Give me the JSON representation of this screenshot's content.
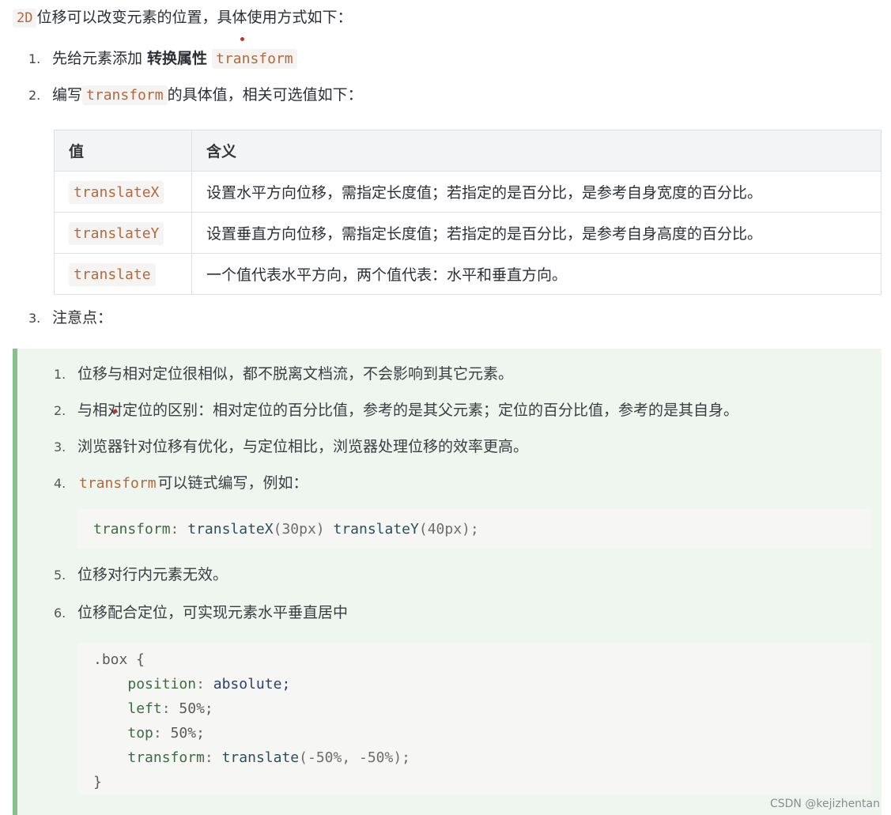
{
  "intro": {
    "code": "2D",
    "text": "位移可以改变元素的位置，具体使用方式如下："
  },
  "steps": [
    {
      "num": "1.",
      "text_before": "先给元素添加 ",
      "bold": "转换属性",
      "code": "transform"
    },
    {
      "num": "2.",
      "text_before": "编写",
      "code": "transform",
      "text_after": "的具体值，相关可选值如下："
    },
    {
      "num": "3.",
      "text": "注意点："
    }
  ],
  "table": {
    "headers": [
      "值",
      "含义"
    ],
    "rows": [
      {
        "value": "translateX",
        "meaning": "设置水平方向位移，需指定长度值；若指定的是百分比，是参考自身宽度的百分比。"
      },
      {
        "value": "translateY",
        "meaning": "设置垂直方向位移，需指定长度值；若指定的是百分比，是参考自身高度的百分比。"
      },
      {
        "value": "translate",
        "meaning": "一个值代表水平方向，两个值代表：水平和垂直方向。"
      }
    ]
  },
  "notes": [
    {
      "num": "1.",
      "text": "位移与相对定位很相似，都不脱离文档流，不会影响到其它元素。"
    },
    {
      "num": "2.",
      "text": "与相对定位的区别：相对定位的百分比值，参考的是其父元素；定位的百分比值，参考的是其自身。"
    },
    {
      "num": "3.",
      "text": "浏览器针对位移有优化，与定位相比，浏览器处理位移的效率更高。"
    },
    {
      "num": "4.",
      "code": "transform",
      "text": "可以链式编写，例如："
    },
    {
      "num": "5.",
      "text": "位移对行内元素无效。"
    },
    {
      "num": "6.",
      "text": "位移配合定位，可实现元素水平垂直居中"
    }
  ],
  "code1": {
    "prop": "transform",
    "colon": ": ",
    "fn1": "translateX",
    "arg1": "(30px)",
    "fn2": "translateY",
    "arg2": "(40px);"
  },
  "code2": {
    "selector": ".box {",
    "lines": [
      {
        "prop": "position",
        "value": "absolute;"
      },
      {
        "prop": "left",
        "value": "50%;"
      },
      {
        "prop": "top",
        "value": "50%;"
      },
      {
        "prop": "transform",
        "fn": "translate",
        "value": "(-50%, -50%);"
      }
    ],
    "close": "}"
  },
  "watermark": "CSDN @kejizhentan"
}
